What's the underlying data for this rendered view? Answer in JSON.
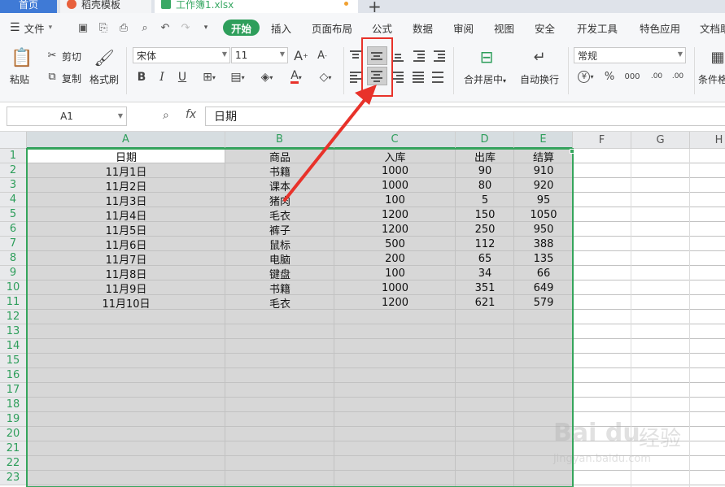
{
  "tabs": [
    {
      "id": "home",
      "label": "首页"
    },
    {
      "id": "tpl",
      "label": "稻壳模板"
    },
    {
      "id": "book",
      "label": "工作簿1.xlsx"
    }
  ],
  "tab_add": "+",
  "menu": {
    "file": "文件",
    "items": [
      "开始",
      "插入",
      "页面布局",
      "公式",
      "数据",
      "审阅",
      "视图",
      "安全",
      "开发工具",
      "特色应用",
      "文档助"
    ]
  },
  "ribbon": {
    "paste": "粘贴",
    "cut": "剪切",
    "copy": "复制",
    "format_painter": "格式刷",
    "font_name": "宋体",
    "font_size": "11",
    "merge_center": "合并居中",
    "wrap_text": "自动换行",
    "number_format": "常规",
    "conditional": "条件格",
    "bold": "B",
    "italic": "I",
    "underline": "U",
    "grow_font": "A",
    "shrink_font": "A",
    "font_color": "A",
    "percent": "%",
    "thousands": "000",
    "inc_decimal": ".00",
    "dec_decimal": ".00",
    "currency": "¥"
  },
  "formula_bar": {
    "name_box": "A1",
    "fx": "fx",
    "content": "日期"
  },
  "columns": [
    "A",
    "B",
    "C",
    "D",
    "E",
    "F",
    "G",
    "H"
  ],
  "rows": [
    "1",
    "2",
    "3",
    "4",
    "5",
    "6",
    "7",
    "8",
    "9",
    "10",
    "11",
    "12",
    "13",
    "14",
    "15",
    "16",
    "17",
    "18",
    "19",
    "20",
    "21",
    "22",
    "23"
  ],
  "table": [
    [
      "日期",
      "商品",
      "入库",
      "出库",
      "结算"
    ],
    [
      "11月1日",
      "书籍",
      "1000",
      "90",
      "910"
    ],
    [
      "11月2日",
      "课本",
      "1000",
      "80",
      "920"
    ],
    [
      "11月3日",
      "猪肉",
      "100",
      "5",
      "95"
    ],
    [
      "11月4日",
      "毛衣",
      "1200",
      "150",
      "1050"
    ],
    [
      "11月5日",
      "裤子",
      "1200",
      "250",
      "950"
    ],
    [
      "11月6日",
      "鼠标",
      "500",
      "112",
      "388"
    ],
    [
      "11月7日",
      "电脑",
      "200",
      "65",
      "135"
    ],
    [
      "11月8日",
      "键盘",
      "100",
      "34",
      "66"
    ],
    [
      "11月9日",
      "书籍",
      "1000",
      "351",
      "649"
    ],
    [
      "11月10日",
      "毛衣",
      "1200",
      "621",
      "579"
    ]
  ],
  "watermark": {
    "logo": "Bai du",
    "text": "经验",
    "url": "jingyan.baidu.com"
  },
  "colors": {
    "accent_green": "#2e9e5b",
    "highlight_red": "#e8322a",
    "tab_blue": "#3f7ad6"
  }
}
